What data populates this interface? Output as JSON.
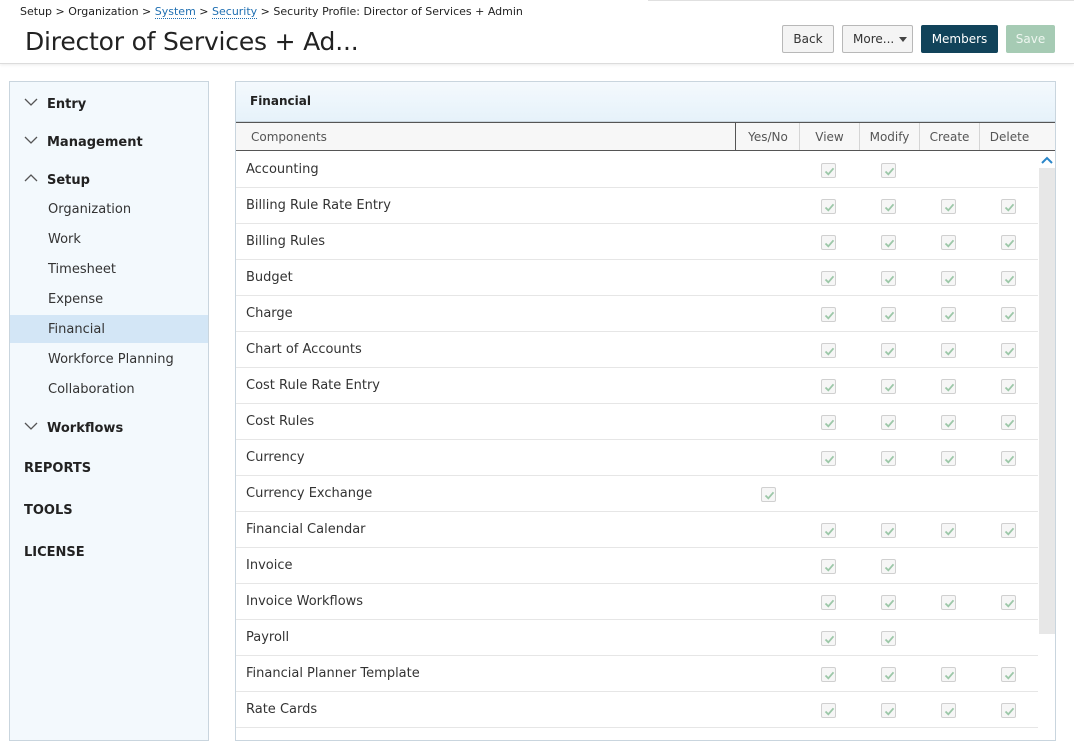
{
  "breadcrumb": {
    "part1": "Setup > Organization > ",
    "system": "System",
    "sep": " > ",
    "security": "Security",
    "part2": " > Security Profile: Director of Services + Admin"
  },
  "page": {
    "title": "Director of Services + Ad..."
  },
  "toolbar": {
    "back": "Back",
    "more": "More...",
    "members": "Members",
    "save": "Save"
  },
  "sidebar": {
    "sections": [
      {
        "label": "Entry",
        "expanded": false
      },
      {
        "label": "Management",
        "expanded": false
      },
      {
        "label": "Setup",
        "expanded": true
      },
      {
        "label": "Workflows",
        "expanded": false
      }
    ],
    "setup_items": [
      "Organization",
      "Work",
      "Timesheet",
      "Expense",
      "Financial",
      "Workforce Planning",
      "Collaboration"
    ],
    "active_item": "Financial",
    "plain": [
      "REPORTS",
      "TOOLS",
      "LICENSE"
    ]
  },
  "panel": {
    "title": "Financial",
    "columns": [
      "Components",
      "Yes/No",
      "View",
      "Modify",
      "Create",
      "Delete"
    ],
    "rows": [
      {
        "name": "Accounting",
        "yesno": false,
        "view": true,
        "modify": true,
        "create": false,
        "delete": false
      },
      {
        "name": "Billing Rule Rate Entry",
        "yesno": false,
        "view": true,
        "modify": true,
        "create": true,
        "delete": true
      },
      {
        "name": "Billing Rules",
        "yesno": false,
        "view": true,
        "modify": true,
        "create": true,
        "delete": true
      },
      {
        "name": "Budget",
        "yesno": false,
        "view": true,
        "modify": true,
        "create": true,
        "delete": true
      },
      {
        "name": "Charge",
        "yesno": false,
        "view": true,
        "modify": true,
        "create": true,
        "delete": true
      },
      {
        "name": "Chart of Accounts",
        "yesno": false,
        "view": true,
        "modify": true,
        "create": true,
        "delete": true
      },
      {
        "name": "Cost Rule Rate Entry",
        "yesno": false,
        "view": true,
        "modify": true,
        "create": true,
        "delete": true
      },
      {
        "name": "Cost Rules",
        "yesno": false,
        "view": true,
        "modify": true,
        "create": true,
        "delete": true
      },
      {
        "name": "Currency",
        "yesno": false,
        "view": true,
        "modify": true,
        "create": true,
        "delete": true
      },
      {
        "name": "Currency Exchange",
        "yesno": true,
        "view": false,
        "modify": false,
        "create": false,
        "delete": false
      },
      {
        "name": "Financial Calendar",
        "yesno": false,
        "view": true,
        "modify": true,
        "create": true,
        "delete": true
      },
      {
        "name": "Invoice",
        "yesno": false,
        "view": true,
        "modify": true,
        "create": false,
        "delete": false
      },
      {
        "name": "Invoice Workflows",
        "yesno": false,
        "view": true,
        "modify": true,
        "create": true,
        "delete": true
      },
      {
        "name": "Payroll",
        "yesno": false,
        "view": true,
        "modify": true,
        "create": false,
        "delete": false
      },
      {
        "name": "Financial Planner Template",
        "yesno": false,
        "view": true,
        "modify": true,
        "create": true,
        "delete": true
      },
      {
        "name": "Rate Cards",
        "yesno": false,
        "view": true,
        "modify": true,
        "create": true,
        "delete": true
      }
    ]
  },
  "colors": {
    "accent": "#11435a",
    "save_disabled": "#a6cbb4",
    "active_nav": "#d3e6f6",
    "check": "#9cc7a8"
  }
}
